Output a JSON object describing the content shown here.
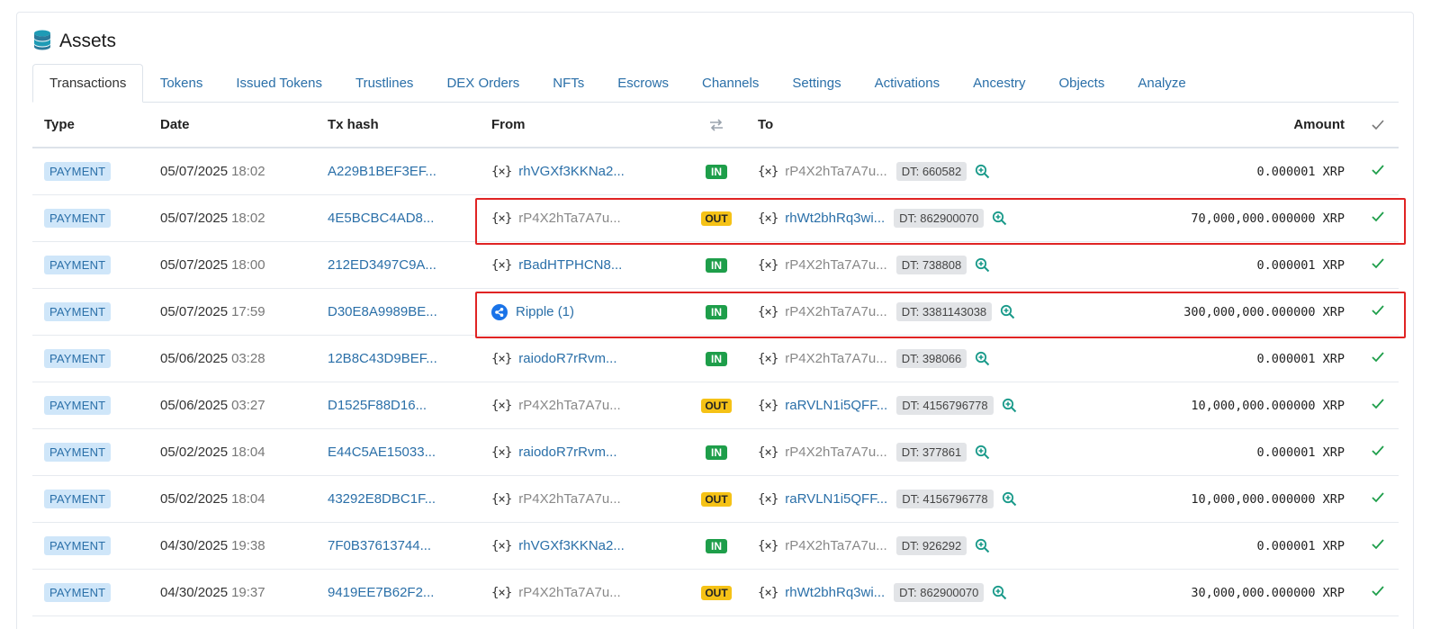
{
  "card": {
    "title": "Assets",
    "title_icon": "database-stack-icon"
  },
  "tabs": [
    {
      "label": "Transactions",
      "active": true
    },
    {
      "label": "Tokens"
    },
    {
      "label": "Issued Tokens"
    },
    {
      "label": "Trustlines"
    },
    {
      "label": "DEX Orders"
    },
    {
      "label": "NFTs"
    },
    {
      "label": "Escrows"
    },
    {
      "label": "Channels"
    },
    {
      "label": "Settings"
    },
    {
      "label": "Activations"
    },
    {
      "label": "Ancestry"
    },
    {
      "label": "Objects"
    },
    {
      "label": "Analyze"
    }
  ],
  "table": {
    "headers": {
      "type": "Type",
      "date": "Date",
      "hash": "Tx hash",
      "from": "From",
      "dir_icon": "swap-arrows-icon",
      "to": "To",
      "amount": "Amount",
      "check_icon": "check-icon"
    },
    "rows": [
      {
        "type": "PAYMENT",
        "date": "05/07/2025",
        "time": "18:02",
        "hash": "A229B1BEF3EF...",
        "from": "rhVGXf3KKNa2...",
        "from_kind": "link",
        "dir": "IN",
        "to": "rP4X2hTa7A7u...",
        "to_kind": "self",
        "dt": "DT: 660582",
        "amount": "0.000001 XRP"
      },
      {
        "type": "PAYMENT",
        "date": "05/07/2025",
        "time": "18:02",
        "hash": "4E5BCBC4AD8...",
        "from": "rP4X2hTa7A7u...",
        "from_kind": "self",
        "dir": "OUT",
        "to": "rhWt2bhRq3wi...",
        "to_kind": "link",
        "dt": "DT: 862900070",
        "amount": "70,000,000.000000 XRP"
      },
      {
        "type": "PAYMENT",
        "date": "05/07/2025",
        "time": "18:00",
        "hash": "212ED3497C9A...",
        "from": "rBadHTPHCN8...",
        "from_kind": "link",
        "dir": "IN",
        "to": "rP4X2hTa7A7u...",
        "to_kind": "self",
        "dt": "DT: 738808",
        "amount": "0.000001 XRP"
      },
      {
        "type": "PAYMENT",
        "date": "05/07/2025",
        "time": "17:59",
        "hash": "D30E8A9989BE...",
        "from": "Ripple (1)",
        "from_kind": "ripple",
        "dir": "IN",
        "to": "rP4X2hTa7A7u...",
        "to_kind": "self",
        "dt": "DT: 3381143038",
        "amount": "300,000,000.000000 XRP"
      },
      {
        "type": "PAYMENT",
        "date": "05/06/2025",
        "time": "03:28",
        "hash": "12B8C43D9BEF...",
        "from": "raiodoR7rRvm...",
        "from_kind": "link",
        "dir": "IN",
        "to": "rP4X2hTa7A7u...",
        "to_kind": "self",
        "dt": "DT: 398066",
        "amount": "0.000001 XRP"
      },
      {
        "type": "PAYMENT",
        "date": "05/06/2025",
        "time": "03:27",
        "hash": "D1525F88D16...",
        "from": "rP4X2hTa7A7u...",
        "from_kind": "self",
        "dir": "OUT",
        "to": "raRVLN1i5QFF...",
        "to_kind": "link",
        "dt": "DT: 4156796778",
        "amount": "10,000,000.000000 XRP"
      },
      {
        "type": "PAYMENT",
        "date": "05/02/2025",
        "time": "18:04",
        "hash": "E44C5AE15033...",
        "from": "raiodoR7rRvm...",
        "from_kind": "link",
        "dir": "IN",
        "to": "rP4X2hTa7A7u...",
        "to_kind": "self",
        "dt": "DT: 377861",
        "amount": "0.000001 XRP"
      },
      {
        "type": "PAYMENT",
        "date": "05/02/2025",
        "time": "18:04",
        "hash": "43292E8DBC1F...",
        "from": "rP4X2hTa7A7u...",
        "from_kind": "self",
        "dir": "OUT",
        "to": "raRVLN1i5QFF...",
        "to_kind": "link",
        "dt": "DT: 4156796778",
        "amount": "10,000,000.000000 XRP"
      },
      {
        "type": "PAYMENT",
        "date": "04/30/2025",
        "time": "19:38",
        "hash": "7F0B37613744...",
        "from": "rhVGXf3KKNa2...",
        "from_kind": "link",
        "dir": "IN",
        "to": "rP4X2hTa7A7u...",
        "to_kind": "self",
        "dt": "DT: 926292",
        "amount": "0.000001 XRP"
      },
      {
        "type": "PAYMENT",
        "date": "04/30/2025",
        "time": "19:37",
        "hash": "9419EE7B62F2...",
        "from": "rP4X2hTa7A7u...",
        "from_kind": "self",
        "dir": "OUT",
        "to": "rhWt2bhRq3wi...",
        "to_kind": "link",
        "dt": "DT: 862900070",
        "amount": "30,000,000.000000 XRP"
      }
    ]
  },
  "colors": {
    "link": "#2a6fa8",
    "in_badge": "#1e9e4a",
    "out_badge": "#f5c216",
    "highlight": "#e02424",
    "check": "#1e9e4a",
    "zoom": "#1a9a8a"
  }
}
